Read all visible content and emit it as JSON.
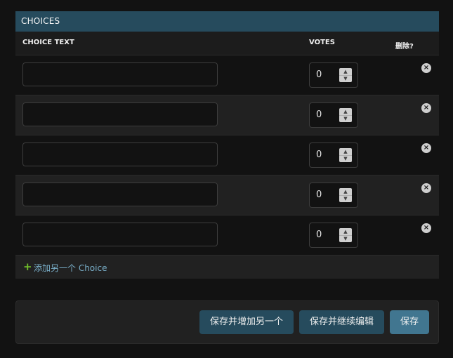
{
  "inline": {
    "title": "CHOICES",
    "columns": {
      "choice_text": "CHOICE TEXT",
      "votes": "VOTES",
      "delete": "删除?"
    },
    "rows": [
      {
        "choice_text": "",
        "votes": "0"
      },
      {
        "choice_text": "",
        "votes": "0"
      },
      {
        "choice_text": "",
        "votes": "0"
      },
      {
        "choice_text": "",
        "votes": "0"
      },
      {
        "choice_text": "",
        "votes": "0"
      }
    ],
    "add_another": {
      "icon": "+",
      "label": "添加另一个 Choice"
    }
  },
  "submit": {
    "save_add_another": "保存并增加另一个",
    "save_continue": "保存并继续编辑",
    "save": "保存"
  },
  "icons": {
    "delete": "close-circle-icon",
    "add": "plus-icon",
    "spinner_up": "chevron-up-icon",
    "spinner_down": "chevron-down-icon"
  },
  "colors": {
    "header_bg": "#264b5d",
    "primary_button": "#417690",
    "add_link": "#79aec8",
    "add_icon": "#70bf2b"
  }
}
